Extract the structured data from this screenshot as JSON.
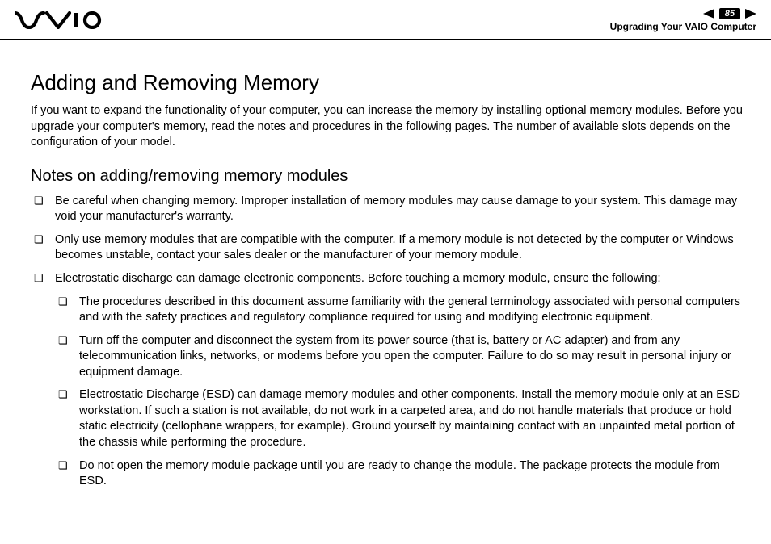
{
  "header": {
    "page_number": "85",
    "section": "Upgrading Your VAIO Computer"
  },
  "content": {
    "title": "Adding and Removing Memory",
    "intro": "If you want to expand the functionality of your computer, you can increase the memory by installing optional memory modules. Before you upgrade your computer's memory, read the notes and procedures in the following pages. The number of available slots depends on the configuration of your model.",
    "subtitle": "Notes on adding/removing memory modules",
    "notes": [
      "Be careful when changing memory. Improper installation of memory modules may cause damage to your system. This damage may void your manufacturer's warranty.",
      "Only use memory modules that are compatible with the computer. If a memory module is not detected by the computer or Windows becomes unstable, contact your sales dealer or the manufacturer of your memory module.",
      "Electrostatic discharge can damage electronic components. Before touching a memory module, ensure the following:"
    ],
    "subnotes": [
      "The procedures described in this document assume familiarity with the general terminology associated with personal computers and with the safety practices and regulatory compliance required for using and modifying electronic equipment.",
      "Turn off the computer and disconnect the system from its power source (that is, battery or AC adapter) and from any telecommunication links, networks, or modems before you open the computer. Failure to do so may result in personal injury or equipment damage.",
      "Electrostatic Discharge (ESD) can damage memory modules and other components. Install the memory module only at an ESD workstation. If such a station is not available, do not work in a carpeted area, and do not handle materials that produce or hold static electricity (cellophane wrappers, for example). Ground yourself by maintaining contact with an unpainted metal portion of the chassis while performing the procedure.",
      "Do not open the memory module package until you are ready to change the module. The package protects the module from ESD."
    ]
  }
}
